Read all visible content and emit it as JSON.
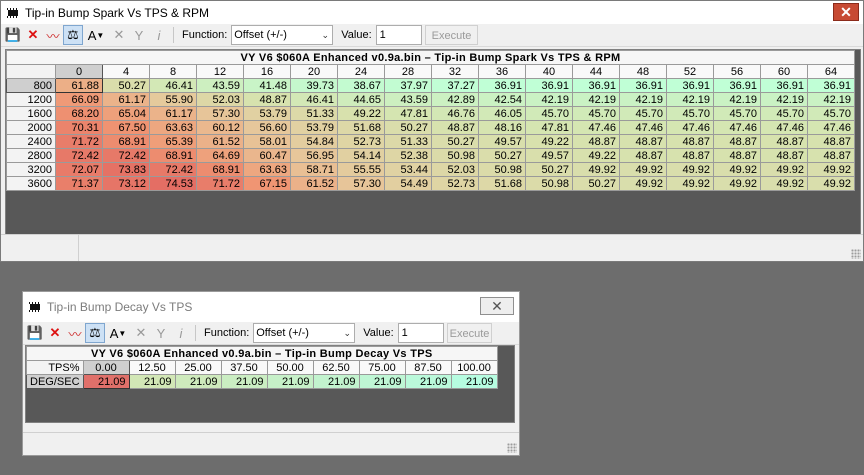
{
  "win1": {
    "title": "Tip-in Bump Spark Vs TPS & RPM",
    "close_label": "✕",
    "toolbar": {
      "function_label": "Function:",
      "function_value": "Offset (+/-)",
      "value_label": "Value:",
      "value": "1",
      "execute_label": "Execute"
    },
    "table": {
      "title": "VY  V6  $060A  Enhanced  v0.9a.bin – Tip-in Bump Spark Vs TPS & RPM",
      "columns": [
        "0",
        "4",
        "8",
        "12",
        "16",
        "20",
        "24",
        "28",
        "32",
        "36",
        "40",
        "44",
        "48",
        "52",
        "56",
        "60",
        "64"
      ],
      "rows": [
        {
          "label": "800",
          "values": [
            "61.88",
            "50.27",
            "46.41",
            "43.59",
            "41.48",
            "39.73",
            "38.67",
            "37.97",
            "37.27",
            "36.91",
            "36.91",
            "36.91",
            "36.91",
            "36.91",
            "36.91",
            "36.91",
            "36.91"
          ]
        },
        {
          "label": "1200",
          "values": [
            "66.09",
            "61.17",
            "55.90",
            "52.03",
            "48.87",
            "46.41",
            "44.65",
            "43.59",
            "42.89",
            "42.54",
            "42.19",
            "42.19",
            "42.19",
            "42.19",
            "42.19",
            "42.19",
            "42.19"
          ]
        },
        {
          "label": "1600",
          "values": [
            "68.20",
            "65.04",
            "61.17",
            "57.30",
            "53.79",
            "51.33",
            "49.22",
            "47.81",
            "46.76",
            "46.05",
            "45.70",
            "45.70",
            "45.70",
            "45.70",
            "45.70",
            "45.70",
            "45.70"
          ]
        },
        {
          "label": "2000",
          "values": [
            "70.31",
            "67.50",
            "63.63",
            "60.12",
            "56.60",
            "53.79",
            "51.68",
            "50.27",
            "48.87",
            "48.16",
            "47.81",
            "47.46",
            "47.46",
            "47.46",
            "47.46",
            "47.46",
            "47.46"
          ]
        },
        {
          "label": "2400",
          "values": [
            "71.72",
            "68.91",
            "65.39",
            "61.52",
            "58.01",
            "54.84",
            "52.73",
            "51.33",
            "50.27",
            "49.57",
            "49.22",
            "48.87",
            "48.87",
            "48.87",
            "48.87",
            "48.87",
            "48.87"
          ]
        },
        {
          "label": "2800",
          "values": [
            "72.42",
            "72.42",
            "68.91",
            "64.69",
            "60.47",
            "56.95",
            "54.14",
            "52.38",
            "50.98",
            "50.27",
            "49.57",
            "49.22",
            "48.87",
            "48.87",
            "48.87",
            "48.87",
            "48.87"
          ]
        },
        {
          "label": "3200",
          "values": [
            "72.07",
            "73.83",
            "72.42",
            "68.91",
            "63.63",
            "58.71",
            "55.55",
            "53.44",
            "52.03",
            "50.98",
            "50.27",
            "49.92",
            "49.92",
            "49.92",
            "49.92",
            "49.92",
            "49.92"
          ]
        },
        {
          "label": "3600",
          "values": [
            "71.37",
            "73.12",
            "74.53",
            "71.72",
            "67.15",
            "61.52",
            "57.30",
            "54.49",
            "52.73",
            "51.68",
            "50.98",
            "50.27",
            "49.92",
            "49.92",
            "49.92",
            "49.92",
            "49.92"
          ]
        }
      ]
    }
  },
  "win2": {
    "title": "Tip-in Bump Decay Vs TPS",
    "close_label": "✕",
    "toolbar": {
      "function_label": "Function:",
      "function_value": "Offset (+/-)",
      "value_label": "Value:",
      "value": "1",
      "execute_label": "Execute"
    },
    "table": {
      "title": "VY  V6  $060A  Enhanced  v0.9a.bin – Tip-in Bump Decay Vs TPS",
      "corner": "TPS%",
      "columns": [
        "0.00",
        "12.50",
        "25.00",
        "37.50",
        "50.00",
        "62.50",
        "75.00",
        "87.50",
        "100.00"
      ],
      "row_label": "DEG/SEC",
      "values": [
        "21.09",
        "21.09",
        "21.09",
        "21.09",
        "21.09",
        "21.09",
        "21.09",
        "21.09",
        "21.09"
      ]
    }
  },
  "icons": [
    "save-icon",
    "delete-icon",
    "graph-icon",
    "balance-icon",
    "fill-icon",
    "tool-icon",
    "wand-icon",
    "info-icon"
  ]
}
